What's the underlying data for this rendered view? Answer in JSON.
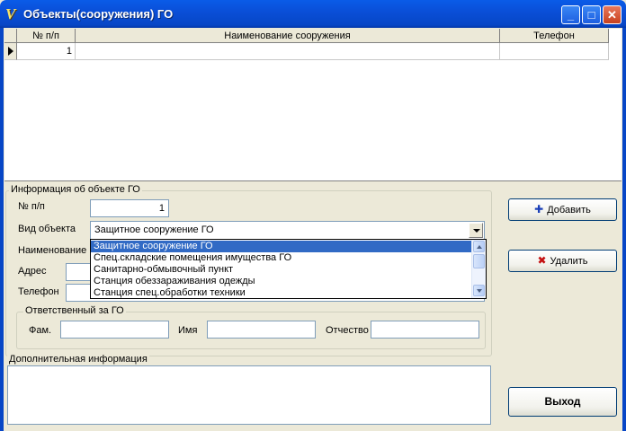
{
  "window": {
    "title": "Объекты(сооружения) ГО",
    "app_icon": "V",
    "controls": [
      "minimize-icon",
      "maximize-icon",
      "close-icon"
    ],
    "control_glyphs": {
      "minimize": "_",
      "maximize": "□",
      "close": "✕"
    }
  },
  "grid": {
    "columns": [
      "№ п/п",
      "Наименование сооружения",
      "Телефон"
    ],
    "rows": [
      {
        "num": "1",
        "name": "",
        "phone": ""
      }
    ]
  },
  "info": {
    "group_title": "Информация об объекте ГО",
    "num_label": "№ п/п",
    "num_value": "1",
    "type_label": "Вид объекта",
    "type_value": "Защитное сооружение ГО",
    "name_label": "Наименование",
    "address_label": "Адрес",
    "phone_label": "Телефон",
    "type_options": [
      "Защитное сооружение ГО",
      "Спец.складские помещения имущества ГО",
      "Санитарно-обмывочный пункт",
      "Станция обеззараживания одежды",
      "Станция спец.обработки техники"
    ],
    "selected_option_index": 0
  },
  "responsible": {
    "group_title": "Ответственный за ГО",
    "last_label": "Фам.",
    "first_label": "Имя",
    "patronymic_label": "Отчество",
    "last_value": "",
    "first_value": "",
    "patronymic_value": ""
  },
  "extra": {
    "group_title": "Дополнительная информация",
    "value": ""
  },
  "buttons": {
    "add_label": "Добавить",
    "add_icon": "plus-icon",
    "add_glyph": "✚",
    "delete_label": "Удалить",
    "delete_icon": "cross-icon",
    "delete_glyph": "✖",
    "exit_label": "Выход"
  },
  "colors": {
    "titlebar": "#0a4fd8",
    "selection": "#316ac5",
    "add_icon": "#1a3fb8",
    "delete_icon": "#c41010"
  }
}
